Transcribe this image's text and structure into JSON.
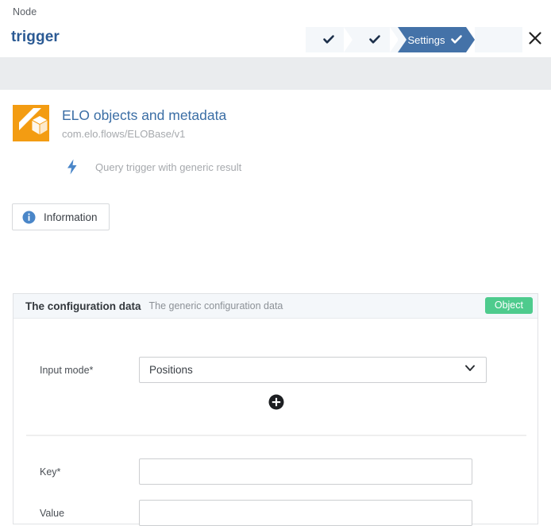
{
  "header": {
    "breadcrumb": "Node",
    "title": "trigger",
    "close_icon": "close-icon",
    "steps": [
      {
        "label": "",
        "state": "done",
        "icon": "check-icon"
      },
      {
        "label": "",
        "state": "done",
        "icon": "check-icon"
      },
      {
        "label": "Settings",
        "state": "active",
        "icon": "check-icon"
      },
      {
        "label": "",
        "state": "upcoming",
        "icon": ""
      }
    ]
  },
  "product": {
    "logo_icon": "elo-cube-logo-icon",
    "title": "ELO objects and metadata",
    "identifier": "com.elo.flows/ELOBase/v1",
    "trigger_icon": "lightning-bolt-icon",
    "trigger_text": "Query trigger with generic result"
  },
  "information_button": {
    "icon": "info-circle-icon",
    "label": "Information"
  },
  "configuration_panel": {
    "title": "The configuration data",
    "description": "The generic configuration data",
    "badge": "Object",
    "fields": {
      "input_mode": {
        "label": "Input mode*",
        "value": "Positions",
        "chevron_icon": "chevron-down-icon"
      },
      "add_button": {
        "icon": "plus-circle-icon"
      },
      "key": {
        "label": "Key*",
        "value": "",
        "placeholder": ""
      },
      "value": {
        "label": "Value",
        "value": "",
        "placeholder": ""
      }
    }
  },
  "colors": {
    "accent_blue": "#3b6ea5",
    "step_active": "#4472a8",
    "badge_green": "#4ecb8d",
    "logo_orange": "#f39c12",
    "band_gray": "#eaecee"
  }
}
